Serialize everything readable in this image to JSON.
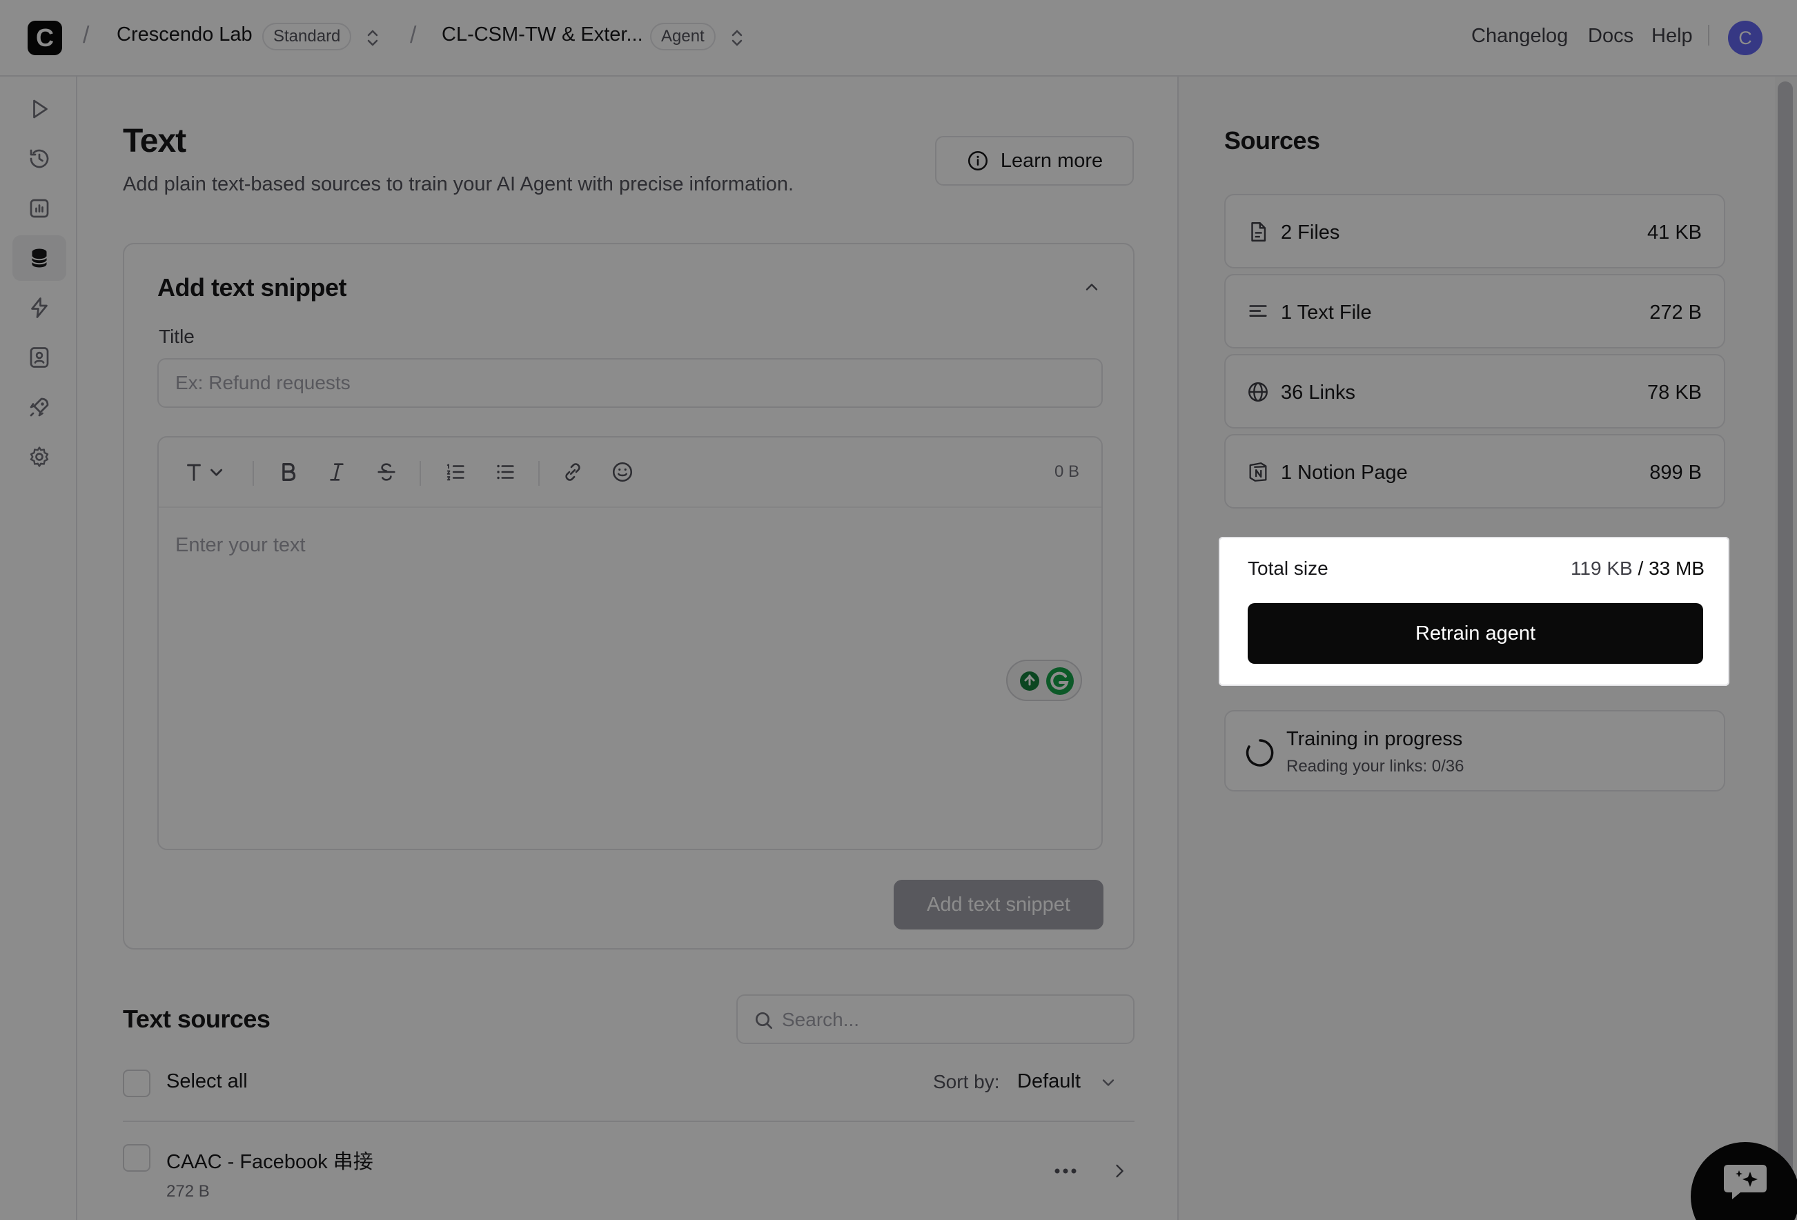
{
  "topbar": {
    "logo_letter": "C",
    "workspace": "Crescendo Lab",
    "workspace_badge": "Standard",
    "agent": "CL-CSM-TW & Exter...",
    "agent_badge": "Agent",
    "nav": [
      "Changelog",
      "Docs",
      "Help"
    ],
    "avatar_letter": "C"
  },
  "rail": {
    "icons": [
      "play-icon",
      "history-icon",
      "analytics-icon",
      "sources-database-icon",
      "actions-bolt-icon",
      "contacts-icon",
      "deploy-rocket-icon",
      "settings-gear-icon"
    ],
    "active": "sources-database-icon"
  },
  "main": {
    "title": "Text",
    "subtitle": "Add plain text-based sources to train your AI Agent with precise information.",
    "learn_more": "Learn more",
    "snippet_card": {
      "title": "Add text snippet",
      "title_field_label": "Title",
      "title_placeholder": "Ex: Refund requests",
      "editor_size": "0 B",
      "editor_placeholder": "Enter your text",
      "add_button": "Add text snippet"
    },
    "text_sources": {
      "title": "Text sources",
      "search_placeholder": "Search...",
      "select_all": "Select all",
      "sort_label": "Sort by:",
      "sort_value": "Default",
      "items": [
        {
          "title": "CAAC - Facebook 串接",
          "size": "272 B"
        }
      ]
    }
  },
  "sources_panel": {
    "title": "Sources",
    "rows": [
      {
        "icon": "file-icon",
        "label": "2 Files",
        "size": "41 KB"
      },
      {
        "icon": "text-lines-icon",
        "label": "1 Text File",
        "size": "272 B"
      },
      {
        "icon": "globe-icon",
        "label": "36 Links",
        "size": "78 KB"
      },
      {
        "icon": "notion-icon",
        "label": "1 Notion Page",
        "size": "899 B"
      }
    ],
    "total_label": "Total size",
    "total_used": "119 KB",
    "total_sep": " / ",
    "total_max": "33 MB",
    "retrain_button": "Retrain agent",
    "training_title": "Training in progress",
    "training_sub": "Reading your links: 0/36"
  },
  "colors": {
    "primary": "#0a0a0a",
    "border": "#e4e4e7",
    "avatar": "#6366f1",
    "overlay": "rgba(0,0,0,0.45)"
  }
}
